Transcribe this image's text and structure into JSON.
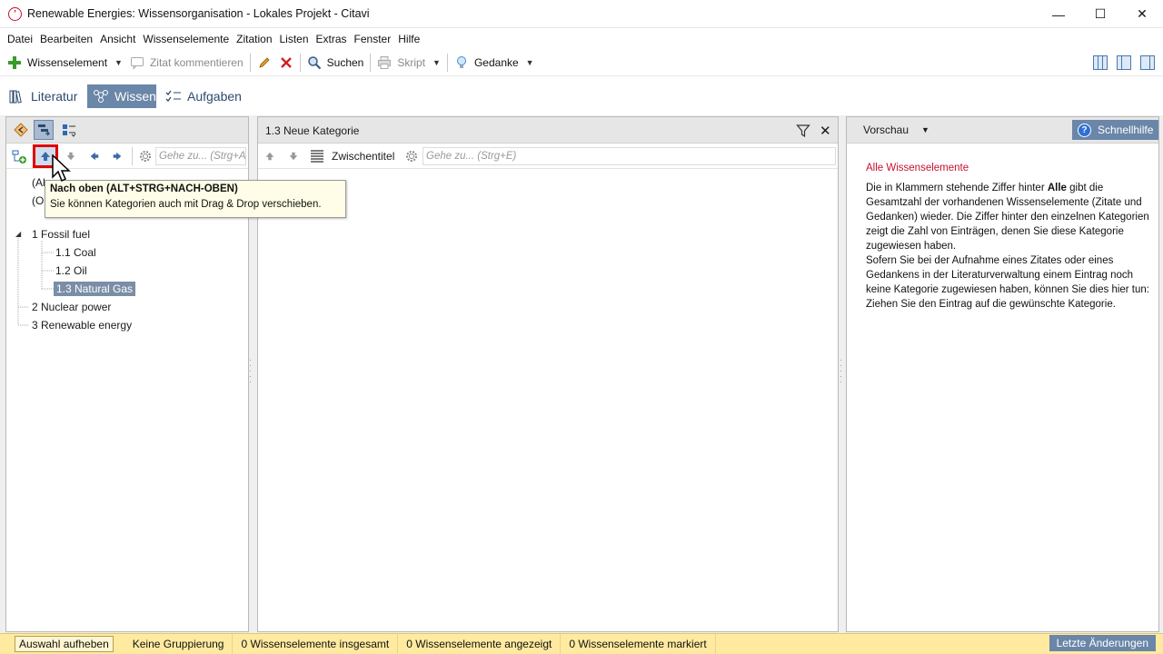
{
  "window": {
    "title": "Renewable Energies: Wissensorganisation - Lokales Projekt - Citavi",
    "app_icon_glyph": "’",
    "minimize": "—",
    "maximize": "☐",
    "close": "✕"
  },
  "menu": [
    "Datei",
    "Bearbeiten",
    "Ansicht",
    "Wissenselemente",
    "Zitation",
    "Listen",
    "Extras",
    "Fenster",
    "Hilfe"
  ],
  "toolbar": {
    "wissenselement": "Wissenselement",
    "zitat_kommentieren": "Zitat kommentieren",
    "suchen": "Suchen",
    "skript": "Skript",
    "gedanke": "Gedanke"
  },
  "modes": {
    "literatur": "Literatur",
    "wissen": "Wissen",
    "aufgaben": "Aufgaben",
    "active": "Wissen"
  },
  "left_panel": {
    "goto_placeholder": "Gehe zu... (Strg+A",
    "tree_hidden_1": "(Al",
    "tree_hidden_2": "(Ol",
    "tree": {
      "n1": "1 Fossil fuel",
      "n1_1": "1.1 Coal",
      "n1_2": "1.2 Oil",
      "n1_3": "1.3 Natural Gas",
      "n2": "2 Nuclear power",
      "n3": "3 Renewable energy"
    }
  },
  "tooltip": {
    "title": "Nach oben (ALT+STRG+NACH-OBEN)",
    "body": "Sie können Kategorien auch mit Drag & Drop verschieben."
  },
  "mid_panel": {
    "title": "1.3 Neue Kategorie",
    "zwischentitel": "Zwischentitel",
    "goto_placeholder": "Gehe zu... (Strg+E)"
  },
  "right_panel": {
    "vorschau": "Vorschau",
    "schnellhilfe": "Schnellhilfe",
    "help_title": "Alle Wissenselemente",
    "p1_a": "Die in Klammern stehende Ziffer hinter ",
    "p1_bold": "Alle",
    "p1_b": " gibt die Gesamtzahl der vorhandenen Wissenselemente (Zitate und Gedanken) wieder. Die Ziffer hinter den einzelnen Kategorien zeigt die Zahl von Einträgen, denen Sie diese Kategorie zugewiesen haben.",
    "p2": "Sofern Sie bei der Aufnahme eines Zitates oder eines Gedankens in der Literaturverwaltung einem Eintrag noch keine Kategorie zugewiesen haben, können Sie dies hier tun: Ziehen Sie den Eintrag auf die gewünschte Kategorie."
  },
  "status": {
    "auswahl_aufheben": "Auswahl aufheben",
    "gruppierung": "Keine Gruppierung",
    "insgesamt": "0 Wissenselemente insgesamt",
    "angezeigt": "0 Wissenselemente angezeigt",
    "markiert": "0 Wissenselemente markiert",
    "letzte_aenderungen": "Letzte Änderungen"
  },
  "colors": {
    "accent": "#6a86a8",
    "highlight_red": "#e00000",
    "help_title": "#c8102e",
    "status_bg": "#ffeaa0"
  }
}
